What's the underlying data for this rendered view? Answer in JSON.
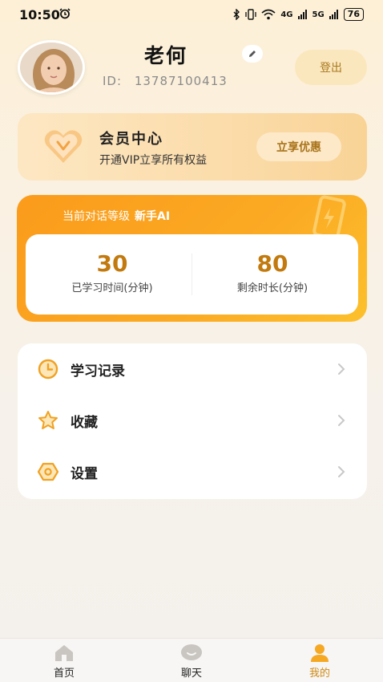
{
  "status_bar": {
    "time": "10:50",
    "signal_1": "4G",
    "signal_2": "5G",
    "battery": "76"
  },
  "profile": {
    "name": "老何",
    "id_label": "ID:",
    "id_value": "13787100413",
    "logout_label": "登出"
  },
  "vip": {
    "title": "会员中心",
    "subtitle": "开通VIP立享所有权益",
    "cta_label": "立享优惠"
  },
  "level": {
    "prefix": "当前对话等级",
    "value": "新手AI",
    "stats": [
      {
        "number": "30",
        "label": "已学习时间(分钟)"
      },
      {
        "number": "80",
        "label": "剩余时长(分钟)"
      }
    ]
  },
  "menu": {
    "items": [
      {
        "label": "学习记录",
        "icon": "clock-icon"
      },
      {
        "label": "收藏",
        "icon": "star-icon"
      },
      {
        "label": "设置",
        "icon": "settings-hexagon-icon"
      }
    ]
  },
  "tabs": [
    {
      "label": "首页",
      "icon": "home-icon",
      "active": false
    },
    {
      "label": "聊天",
      "icon": "chat-icon",
      "active": false
    },
    {
      "label": "我的",
      "icon": "person-icon",
      "active": true
    }
  ],
  "colors": {
    "accent": "#fba323",
    "accent_text": "#c27a0e",
    "active_tab": "#d08a16",
    "icon_inactive": "#c9c6c1"
  }
}
